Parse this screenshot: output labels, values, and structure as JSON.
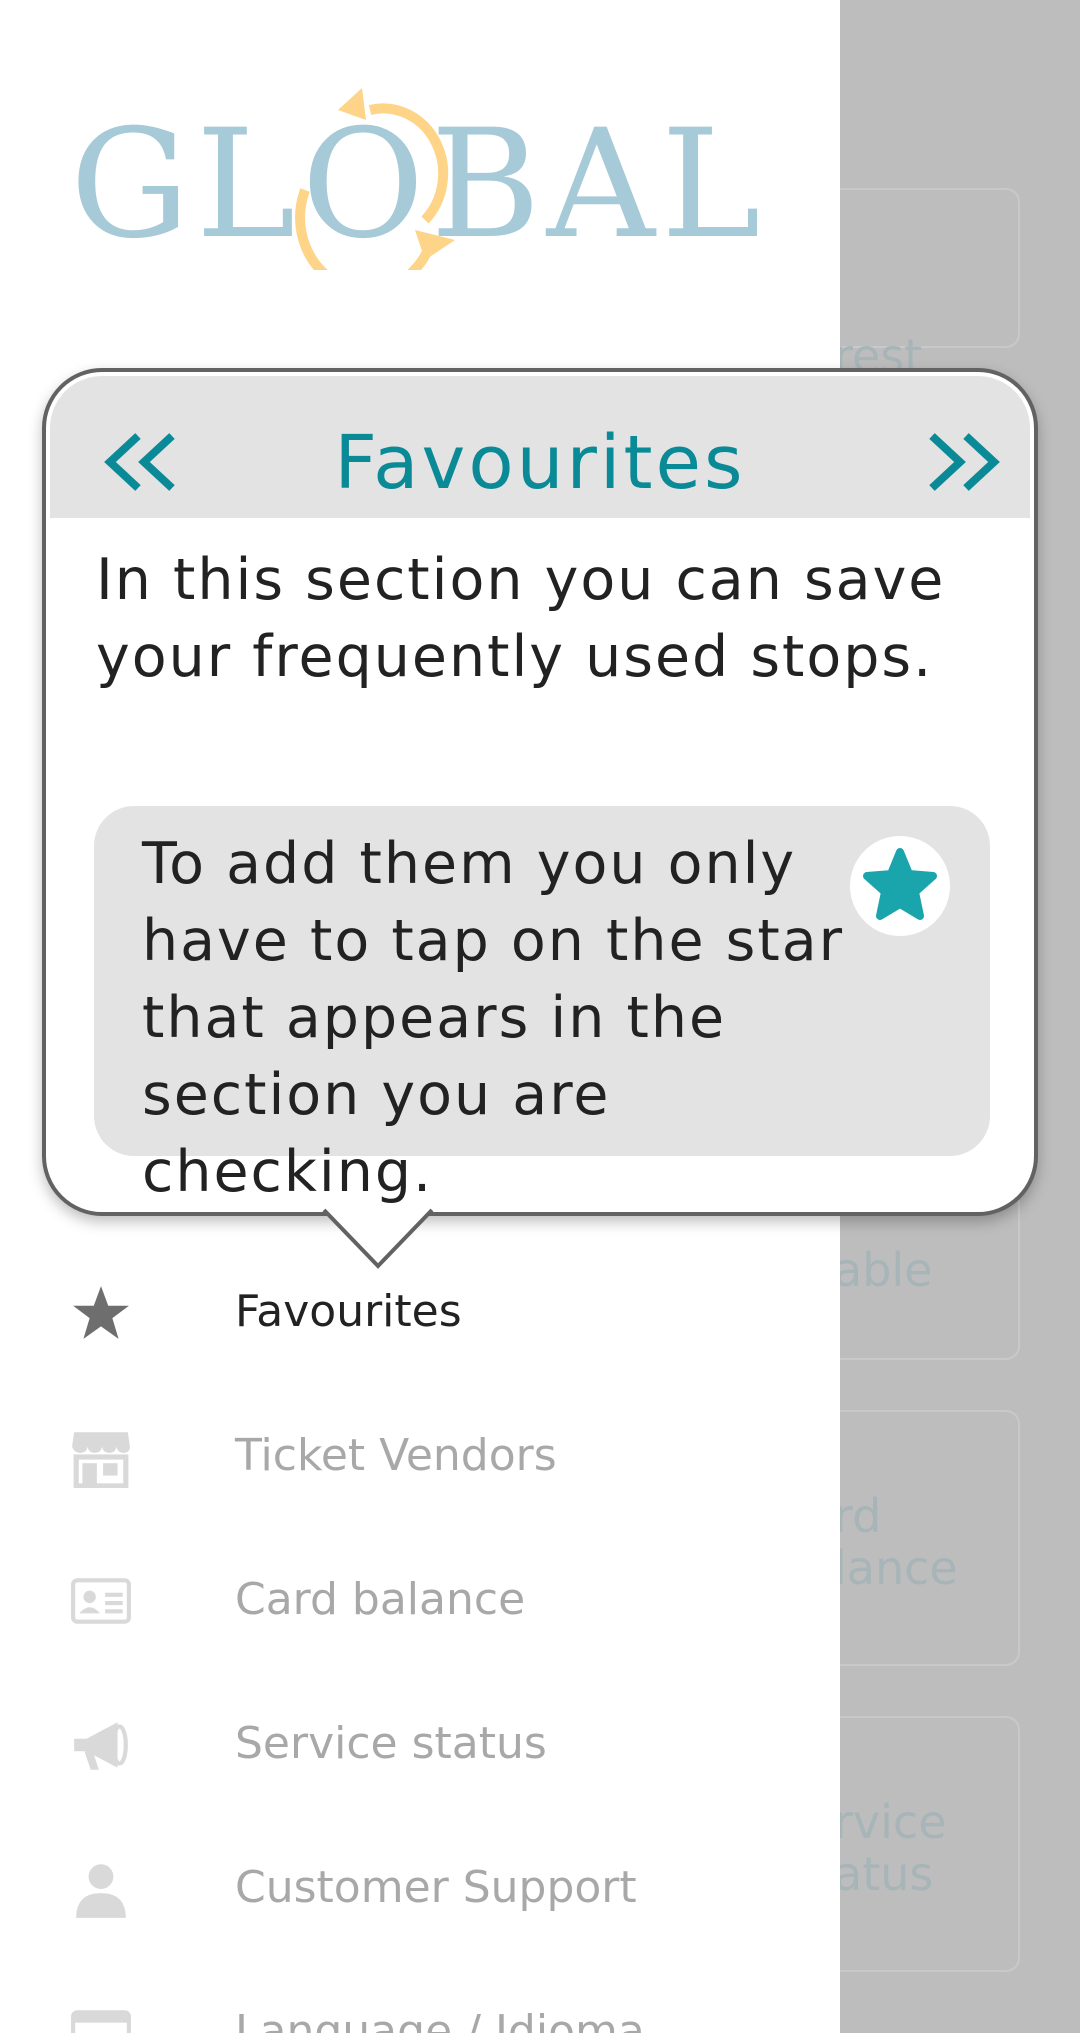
{
  "background": {
    "cards": [
      {
        "label": "rest"
      },
      {
        "label": "able"
      },
      {
        "label": "rd\nlance"
      },
      {
        "label": "rvice\natus"
      }
    ]
  },
  "logo": {
    "text": "GLOBAL"
  },
  "popup": {
    "title": "Favourites",
    "prev_icon": "double-chevron-left",
    "next_icon": "double-chevron-right",
    "text": "In this section you can save your frequently used stops.",
    "tip_text": "To add them you only have to tap on the star that appears in the section you are checking.",
    "accent_color": "#0a8a96",
    "star_color": "#1aa5ad"
  },
  "menu": {
    "items": [
      {
        "label": "Favourites",
        "icon": "star-icon",
        "active": true
      },
      {
        "label": "Ticket Vendors",
        "icon": "store-icon",
        "active": false
      },
      {
        "label": "Card balance",
        "icon": "id-card-icon",
        "active": false
      },
      {
        "label": "Service status",
        "icon": "megaphone-icon",
        "active": false
      },
      {
        "label": "Customer Support",
        "icon": "person-icon",
        "active": false
      },
      {
        "label": "Language / Idioma",
        "icon": "language-icon",
        "active": false
      }
    ]
  }
}
